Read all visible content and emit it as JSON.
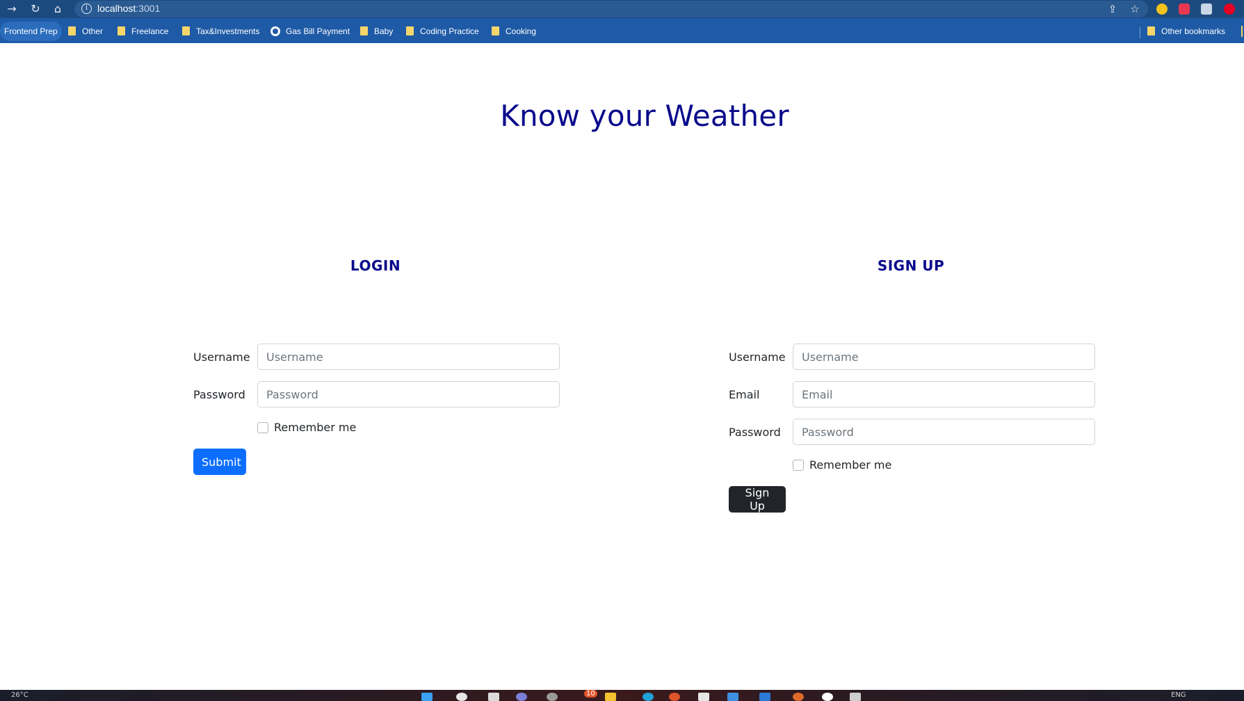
{
  "browser": {
    "url_host": "localhost",
    "url_port": ":3001",
    "bookmarks": [
      {
        "label": "Frontend Prep",
        "type": "active"
      },
      {
        "label": "Other",
        "type": "folder"
      },
      {
        "label": "Freelance",
        "type": "folder"
      },
      {
        "label": "Tax&Investments",
        "type": "folder"
      },
      {
        "label": "Gas Bill Payment",
        "type": "site"
      },
      {
        "label": "Baby",
        "type": "folder"
      },
      {
        "label": "Coding Practice",
        "type": "folder"
      },
      {
        "label": "Cooking",
        "type": "folder"
      }
    ],
    "other_bookmarks": "Other bookmarks"
  },
  "page": {
    "title": "Know your Weather"
  },
  "login": {
    "heading": "LOGIN",
    "username_label": "Username",
    "username_placeholder": "Username",
    "username_value": "",
    "password_label": "Password",
    "password_placeholder": "Password",
    "password_value": "",
    "remember_label": "Remember me",
    "submit_label": "Submit"
  },
  "signup": {
    "heading": "SIGN UP",
    "username_label": "Username",
    "username_placeholder": "Username",
    "username_value": "",
    "email_label": "Email",
    "email_placeholder": "Email",
    "email_value": "",
    "password_label": "Password",
    "password_placeholder": "Password",
    "password_value": "",
    "remember_label": "Remember me",
    "submit_label": "Sign Up"
  },
  "taskbar": {
    "weather": "26°C",
    "lang": "ENG",
    "badge": "10"
  },
  "colors": {
    "heading": "#0a0a8c",
    "primary": "#0d6efd",
    "dark": "#212529",
    "chrome": "#1d4a7e",
    "bookmarks_bar": "#1e5aa6"
  }
}
